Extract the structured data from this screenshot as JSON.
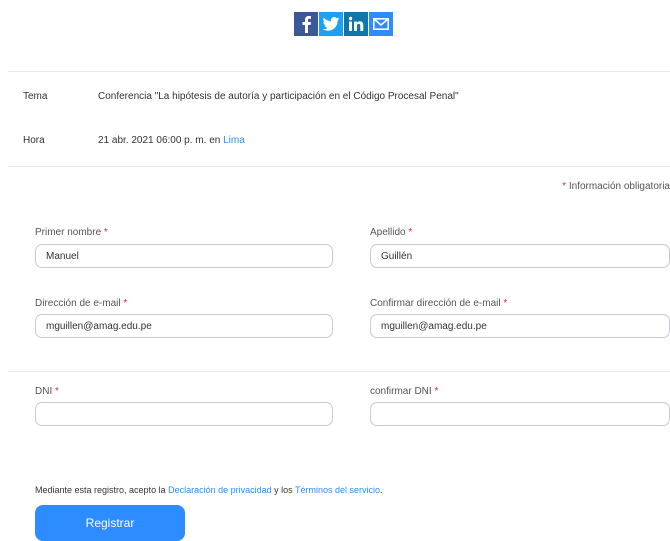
{
  "share": {
    "icons": [
      "facebook-icon",
      "twitter-icon",
      "linkedin-icon",
      "email-icon"
    ],
    "colors": {
      "facebook": "#3b5998",
      "twitter": "#1da1f2",
      "linkedin": "#0e76a8",
      "email": "#2d8cff"
    }
  },
  "meeting": {
    "topic_label": "Tema",
    "topic_value": "Conferencia \"La hipótesis de autoría y participación en el Código Procesal Penal\"",
    "time_label": "Hora",
    "time_value": "21 abr. 2021 06:00 p. m. en ",
    "time_zone": "Lima"
  },
  "form": {
    "required_star": "*",
    "required_note": "Información obligatoria",
    "fields": {
      "first_name": {
        "label": "Primer nombre",
        "value": "Manuel"
      },
      "last_name": {
        "label": "Apellido",
        "value": "Guillén"
      },
      "email": {
        "label": "Dirección de e-mail",
        "value": "mguillen@amag.edu.pe"
      },
      "confirm_email": {
        "label": "Confirmar dirección de e-mail",
        "value": "mguillen@amag.edu.pe"
      },
      "dni": {
        "label": "DNI",
        "value": ""
      },
      "confirm_dni": {
        "label": "confirmar DNI",
        "value": ""
      }
    },
    "consent": {
      "prefix": "Mediante esta registro, acepto la ",
      "privacy_link": "Declaración de privacidad",
      "middle": " y los ",
      "terms_link": "Términos del servicio",
      "suffix": "."
    },
    "submit_label": "Registrar"
  },
  "colors": {
    "accent": "#2d8cff",
    "required": "#e02828"
  }
}
